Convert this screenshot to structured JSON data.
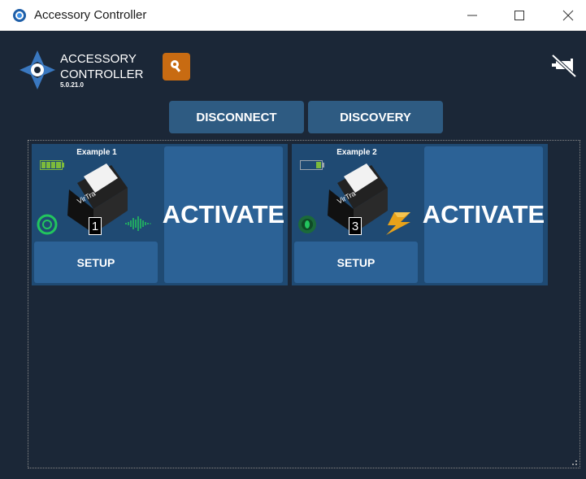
{
  "window": {
    "title": "Accessory Controller",
    "minimize_label": "minimize",
    "maximize_label": "maximize",
    "close_label": "close"
  },
  "header": {
    "logo_line1": "ACCESSORY",
    "logo_line2": "CONTROLLER",
    "version": "5.0.21.0",
    "key_icon": "key-icon",
    "pin_icon": "unpin-icon"
  },
  "toolbar": {
    "disconnect_label": "DISCONNECT",
    "discovery_label": "DISCOVERY"
  },
  "devices": [
    {
      "name": "Example 1",
      "unit_number": "1",
      "setup_label": "SETUP",
      "activate_label": "ACTIVATE",
      "battery_level": 1.0,
      "status_indicator": "signal-waveform-icon",
      "status_color": "#22c55e"
    },
    {
      "name": "Example 2",
      "unit_number": "3",
      "setup_label": "SETUP",
      "activate_label": "ACTIVATE",
      "battery_level": 0.25,
      "status_indicator": "charging-bolt-icon",
      "status_color": "#e8a21a"
    }
  ],
  "colors": {
    "background": "#1b2737",
    "card": "#1f4a73",
    "button": "#2c6296",
    "accent_orange": "#c86b12",
    "status_green": "#22c55e"
  }
}
